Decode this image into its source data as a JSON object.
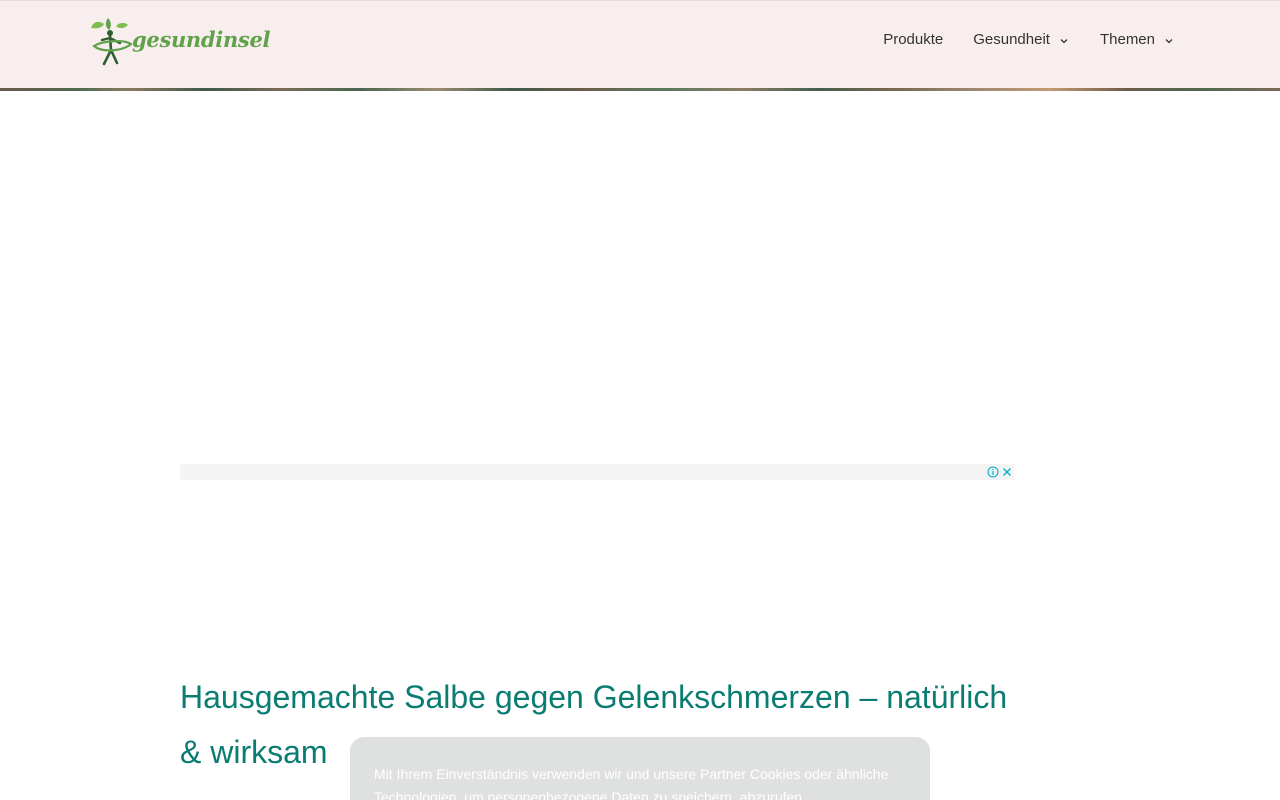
{
  "header": {
    "logo_text": "gesundinsel",
    "nav": [
      {
        "label": "Produkte",
        "has_dropdown": false
      },
      {
        "label": "Gesundheit",
        "has_dropdown": true
      },
      {
        "label": "Themen",
        "has_dropdown": true
      }
    ]
  },
  "ad": {
    "info_icon": "info-icon",
    "close_icon": "close-icon",
    "accent_color": "#00aecd"
  },
  "article": {
    "title": "Hausgemachte Salbe gegen Gelenkschmerzen – natürlich & wirksam"
  },
  "consent": {
    "text": "Mit Ihrem Einverständnis verwenden wir und unsere Partner Cookies oder ähnliche Technologien, um personenbezogene Daten zu speichern, abzurufen"
  },
  "colors": {
    "header_bg": "#f8eeee",
    "title": "#0a7c72",
    "logo_green": "#5fa24a",
    "consent_bg": "#dfe0e0"
  }
}
